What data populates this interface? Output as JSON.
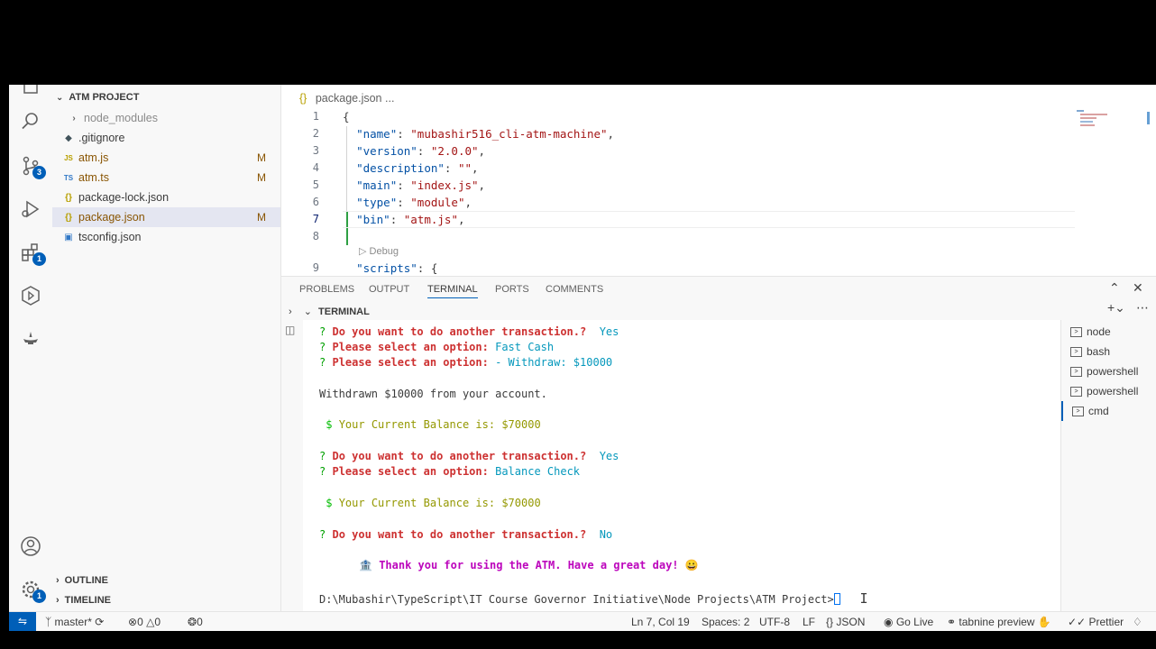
{
  "colors": {
    "accent": "#005fb8",
    "badge": "#005fb8",
    "modified": "#895503"
  },
  "activity_bar": {
    "items": [
      {
        "icon": "files-icon"
      },
      {
        "icon": "search-icon"
      },
      {
        "icon": "source-control-icon",
        "badge": "3"
      },
      {
        "icon": "run-debug-icon"
      },
      {
        "icon": "extensions-icon",
        "badge": "1"
      },
      {
        "icon": "remote-explorer-icon"
      },
      {
        "icon": "genie-icon"
      }
    ],
    "bottom": [
      {
        "icon": "account-icon"
      },
      {
        "icon": "settings-gear-icon",
        "badge": "1"
      }
    ]
  },
  "sidebar": {
    "title": "ATM PROJECT",
    "items": [
      {
        "label": "node_modules",
        "icon": "›",
        "badge": ""
      },
      {
        "label": ".gitignore",
        "icon": "◆",
        "badge": ""
      },
      {
        "label": "atm.js",
        "icon": "JS",
        "badge": "M"
      },
      {
        "label": "atm.ts",
        "icon": "TS",
        "badge": "M"
      },
      {
        "label": "package-lock.json",
        "icon": "{}",
        "badge": ""
      },
      {
        "label": "package.json",
        "icon": "{}",
        "badge": "M"
      },
      {
        "label": "tsconfig.json",
        "icon": "▣",
        "badge": ""
      }
    ],
    "outline": "OUTLINE",
    "timeline": "TIMELINE"
  },
  "editor": {
    "breadcrumb_file": "package.json",
    "breadcrumb_more": "...",
    "line_numbers": [
      "1",
      "2",
      "3",
      "4",
      "5",
      "6",
      "7",
      "8",
      "9"
    ],
    "lines": {
      "l1": "{",
      "l2_key": "\"name\"",
      "l2_val": "\"mubashir516_cli-atm-machine\"",
      "l3_key": "\"version\"",
      "l3_val": "\"2.0.0\"",
      "l4_key": "\"description\"",
      "l4_val": "\"\"",
      "l5_key": "\"main\"",
      "l5_val": "\"index.js\"",
      "l6_key": "\"type\"",
      "l6_val": "\"module\"",
      "l7_key": "\"bin\"",
      "l7_val": "\"atm.js\"",
      "l9_key": "\"scripts\"",
      "l9_rest": ": {"
    },
    "codelens": "Debug"
  },
  "panel": {
    "tabs": [
      "PROBLEMS",
      "OUTPUT",
      "TERMINAL",
      "PORTS",
      "COMMENTS"
    ],
    "active_tab": "TERMINAL",
    "section_title": "TERMINAL",
    "terminal": {
      "q1": "Do you want to do another transaction.?",
      "a1": "Yes",
      "q2": "Please select an option:",
      "a2": "Fast Cash",
      "q3": "Please select an option:",
      "a3": "- Withdraw: $10000",
      "withdrawn": "Withdrawn $10000 from your account.",
      "balance_label": "Your Current Balance is: $70000",
      "q4": "Do you want to do another transaction.?",
      "a4": "Yes",
      "q5": "Please select an option:",
      "a5": "Balance Check",
      "balance_label2": "Your Current Balance is: $70000",
      "q6": "Do you want to do another transaction.?",
      "a6": "No",
      "thanks": "Thank you for using the ATM. Have a great day!",
      "prompt": "D:\\Mubashir\\TypeScript\\IT Course Governor Initiative\\Node Projects\\ATM Project>",
      "question_mark": "?",
      "dollar": "$"
    },
    "terminal_list": [
      "node",
      "bash",
      "powershell",
      "powershell",
      "cmd"
    ]
  },
  "status_bar": {
    "branch": "master*",
    "errors": "0",
    "warnings": "0",
    "ports": "0",
    "cursor": "Ln 7, Col 19",
    "spaces": "Spaces: 2",
    "encoding": "UTF-8",
    "eol": "LF",
    "language": "JSON",
    "go_live": "Go Live",
    "tabnine": "tabnine preview",
    "prettier": "Prettier"
  }
}
